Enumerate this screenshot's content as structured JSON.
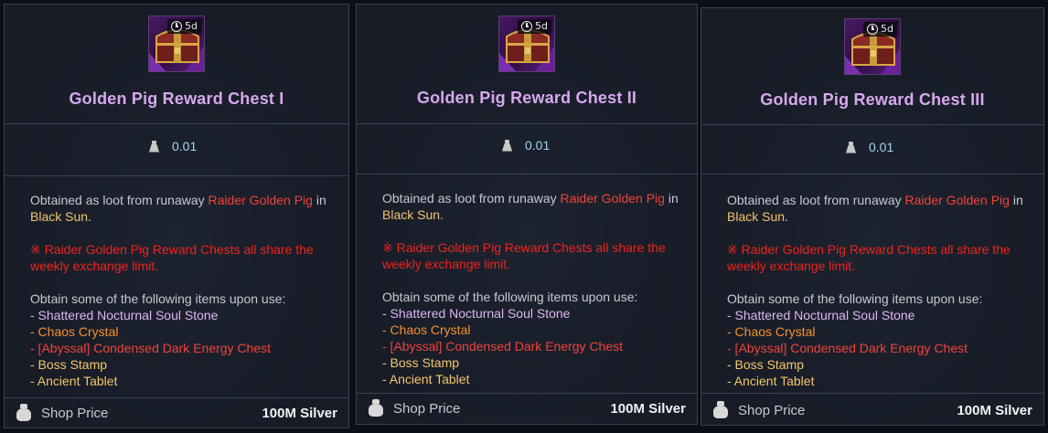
{
  "cards": [
    {
      "title": "Golden Pig Reward Chest I",
      "duration": "5d",
      "weight": "0.01",
      "desc_prefix": "Obtained as loot from runaway ",
      "desc_mob": "Raider Golden Pig",
      "desc_mid": " in ",
      "desc_place": "Black Sun",
      "desc_end": ".",
      "warning": "※ Raider Golden Pig Reward Chests all share the weekly exchange limit.",
      "obtain_header": "Obtain some of the following items upon use:",
      "items": [
        "- Shattered Nocturnal Soul Stone",
        "- Chaos Crystal",
        "- [Abyssal] Condensed Dark Energy Chest",
        "- Boss Stamp",
        "- Ancient Tablet"
      ],
      "shop_label": "Shop Price",
      "price": "100M Silver"
    },
    {
      "title": "Golden Pig Reward Chest II",
      "duration": "5d",
      "weight": "0.01",
      "desc_prefix": "Obtained as loot from runaway ",
      "desc_mob": "Raider Golden Pig",
      "desc_mid": " in ",
      "desc_place": "Black Sun",
      "desc_end": ".",
      "warning": "※ Raider Golden Pig Reward Chests all share the weekly exchange limit.",
      "obtain_header": "Obtain some of the following items upon use:",
      "items": [
        "- Shattered Nocturnal Soul Stone",
        "- Chaos Crystal",
        "- [Abyssal] Condensed Dark Energy Chest",
        "- Boss Stamp",
        "- Ancient Tablet"
      ],
      "shop_label": "Shop Price",
      "price": "100M Silver"
    },
    {
      "title": "Golden Pig Reward Chest III",
      "duration": "5d",
      "weight": "0.01",
      "desc_prefix": "Obtained as loot from runaway ",
      "desc_mob": "Raider Golden Pig",
      "desc_mid": " in ",
      "desc_place": "Black Sun",
      "desc_end": ".",
      "warning": "※ Raider Golden Pig Reward Chests all share the weekly exchange limit.",
      "obtain_header": "Obtain some of the following items upon use:",
      "items": [
        "- Shattered Nocturnal Soul Stone",
        "- Chaos Crystal",
        "- [Abyssal] Condensed Dark Energy Chest",
        "- Boss Stamp",
        "- Ancient Tablet"
      ],
      "shop_label": "Shop Price",
      "price": "100M Silver"
    }
  ],
  "icons": {
    "chest": "treasure-chest-icon",
    "clock": "clock-icon",
    "weight": "weight-icon",
    "shop": "money-bag-icon"
  },
  "colors": {
    "title": "#d7a8ee",
    "weight": "#9fd7ee",
    "mob": "#f0433c",
    "place": "#f3c56b",
    "warning": "#f0231d",
    "item_purple": "#dcb6f2",
    "item_orange": "#f3922e",
    "item_red": "#f0433c",
    "item_yellow": "#f3c56b"
  }
}
